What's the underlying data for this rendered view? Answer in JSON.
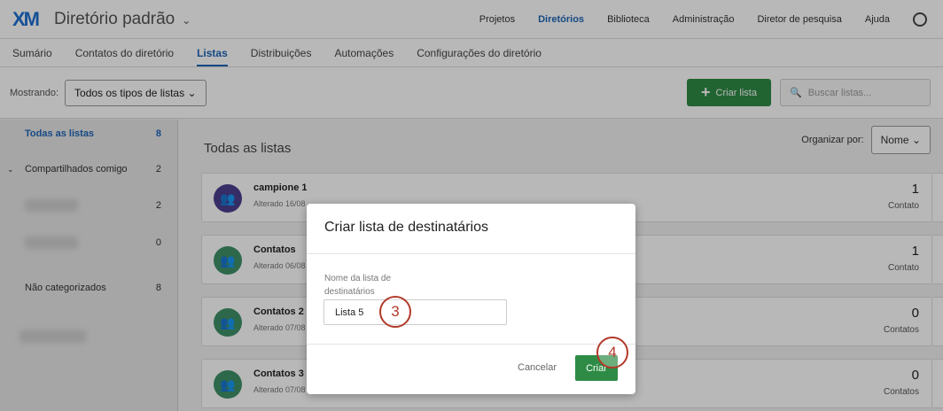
{
  "header": {
    "logo": "XM",
    "directory": "Diretório padrão",
    "nav": [
      "Projetos",
      "Diretórios",
      "Biblioteca",
      "Administração",
      "Diretor de pesquisa",
      "Ajuda"
    ],
    "active_nav": "Diretórios"
  },
  "tabs": [
    "Sumário",
    "Contatos do diretório",
    "Listas",
    "Distribuições",
    "Automações",
    "Configurações do diretório"
  ],
  "toolbar": {
    "showing_label": "Mostrando:",
    "filter": "Todos os tipos de listas",
    "create_list": "Criar lista",
    "search_placeholder": "Buscar listas..."
  },
  "sidebar": {
    "all": {
      "label": "Todas as listas",
      "count": "8"
    },
    "shared": {
      "label": "Compartilhados comigo",
      "count": "2"
    },
    "sub1_count": "2",
    "sub2_count": "0",
    "uncategorized": {
      "label": "Não categorizados",
      "count": "8"
    }
  },
  "main": {
    "title": "Todas as listas",
    "sort_label": "Organizar por:",
    "sort_value": "Nome",
    "lists": [
      {
        "name": "campione 1",
        "sub": "Alterado 16/08",
        "count": "1",
        "unit": "Contato",
        "color": "#4b3f8f"
      },
      {
        "name": "Contatos",
        "sub": "Alterado 06/08",
        "count": "1",
        "unit": "Contato",
        "color": "#3f9068"
      },
      {
        "name": "Contatos 2",
        "sub": "Alterado 07/08",
        "count": "0",
        "unit": "Contatos",
        "color": "#3f9068"
      },
      {
        "name": "Contatos 3",
        "sub": "Alterado 07/08",
        "count": "0",
        "unit": "Contatos",
        "color": "#3f9068"
      }
    ]
  },
  "modal": {
    "title": "Criar lista de destinatários",
    "field_label": "Nome da lista de destinatários",
    "field_value": "Lista 5",
    "cancel": "Cancelar",
    "create": "Criar"
  },
  "annotations": {
    "step3": "3",
    "step4": "4"
  }
}
